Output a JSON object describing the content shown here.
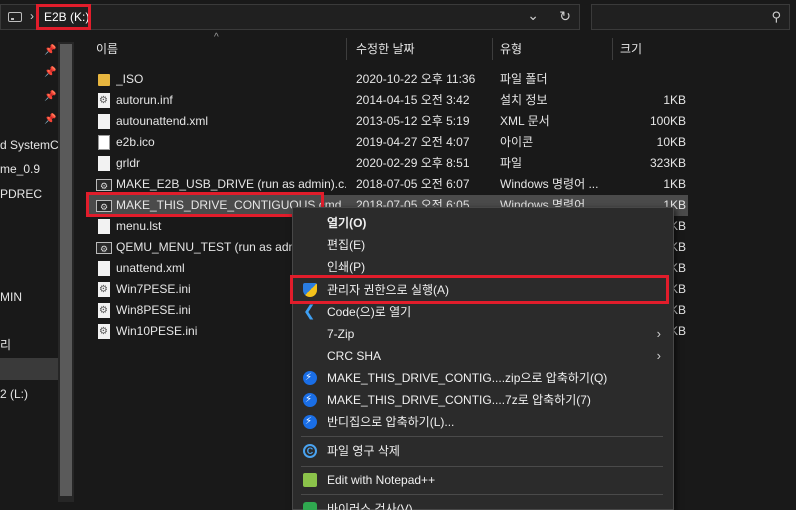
{
  "address": {
    "crumb": "E2B (K:)"
  },
  "search": {
    "placeholder": ""
  },
  "nav": {
    "items": [
      {
        "label": "",
        "pinned": true
      },
      {
        "label": "",
        "pinned": true
      },
      {
        "label": "",
        "pinned": true
      },
      {
        "label": "",
        "pinned": true
      },
      {
        "label": "d SystemCa",
        "pinned": false
      },
      {
        "label": "me_0.9",
        "pinned": false
      },
      {
        "label": "PDREC",
        "pinned": false
      },
      {
        "label": "MIN",
        "pinned": false
      },
      {
        "label": "리",
        "pinned": false
      },
      {
        "label": "2 (L:)",
        "pinned": false
      }
    ]
  },
  "columns": {
    "name": "이름",
    "date": "수정한 날짜",
    "type": "유형",
    "size": "크기"
  },
  "files": [
    {
      "name": "_ISO",
      "date": "2020-10-22 오후 11:36",
      "type": "파일 폴더",
      "size": "",
      "icon": "folder-icon"
    },
    {
      "name": "autorun.inf",
      "date": "2014-04-15 오전 3:42",
      "type": "설치 정보",
      "size": "1KB",
      "icon": "settings-file-icon"
    },
    {
      "name": "autounattend.xml",
      "date": "2013-05-12 오후 5:19",
      "type": "XML 문서",
      "size": "100KB",
      "icon": "document-icon"
    },
    {
      "name": "e2b.ico",
      "date": "2019-04-27 오전 4:07",
      "type": "아이콘",
      "size": "10KB",
      "icon": "image-icon"
    },
    {
      "name": "grldr",
      "date": "2020-02-29 오후 8:51",
      "type": "파일",
      "size": "323KB",
      "icon": "document-icon"
    },
    {
      "name": "MAKE_E2B_USB_DRIVE (run as admin).c...",
      "date": "2018-07-05 오전 6:07",
      "type": "Windows 명령어 ...",
      "size": "1KB",
      "icon": "cmd-icon"
    },
    {
      "name": "MAKE_THIS_DRIVE_CONTIGUOUS.cmd",
      "date": "2018-07-05 오전 6:05",
      "type": "Windows 명령어 ...",
      "size": "1KB",
      "icon": "cmd-icon"
    },
    {
      "name": "menu.lst",
      "date": "",
      "type": "",
      "size": "KB",
      "icon": "document-icon"
    },
    {
      "name": "QEMU_MENU_TEST (run as admin",
      "date": "",
      "type": "",
      "size": "KB",
      "icon": "cmd-icon"
    },
    {
      "name": "unattend.xml",
      "date": "",
      "type": "",
      "size": "KB",
      "icon": "document-icon"
    },
    {
      "name": "Win7PESE.ini",
      "date": "",
      "type": "",
      "size": "KB",
      "icon": "settings-file-icon"
    },
    {
      "name": "Win8PESE.ini",
      "date": "",
      "type": "",
      "size": "KB",
      "icon": "settings-file-icon"
    },
    {
      "name": "Win10PESE.ini",
      "date": "",
      "type": "",
      "size": "KB",
      "icon": "settings-file-icon"
    }
  ],
  "context_menu": {
    "items": [
      {
        "label": "열기(O)",
        "bold": true
      },
      {
        "label": "편집(E)"
      },
      {
        "label": "인쇄(P)"
      },
      {
        "label": "관리자 권한으로 실행(A)",
        "icon": "uac-shield-icon"
      },
      {
        "label": "Code(으)로 열기",
        "icon": "vscode-icon"
      },
      {
        "label": "7-Zip",
        "submenu": true
      },
      {
        "label": "CRC SHA",
        "submenu": true
      },
      {
        "label": "MAKE_THIS_DRIVE_CONTIG....zip으로 압축하기(Q)",
        "icon": "bandizip-icon"
      },
      {
        "label": "MAKE_THIS_DRIVE_CONTIG....7z로 압축하기(7)",
        "icon": "bandizip-icon"
      },
      {
        "label": "반디집으로 압축하기(L)...",
        "icon": "bandizip-icon"
      },
      {
        "label": "파일 영구 삭제",
        "icon": "permanent-delete-icon"
      },
      {
        "label": "Edit with Notepad++",
        "icon": "notepadpp-icon"
      },
      {
        "label": "바이러스 검사(V)",
        "icon": "antivirus-icon"
      }
    ]
  },
  "colors": {
    "highlight": "#e11d2b",
    "background": "#191919",
    "menu": "#2b2b2b"
  }
}
